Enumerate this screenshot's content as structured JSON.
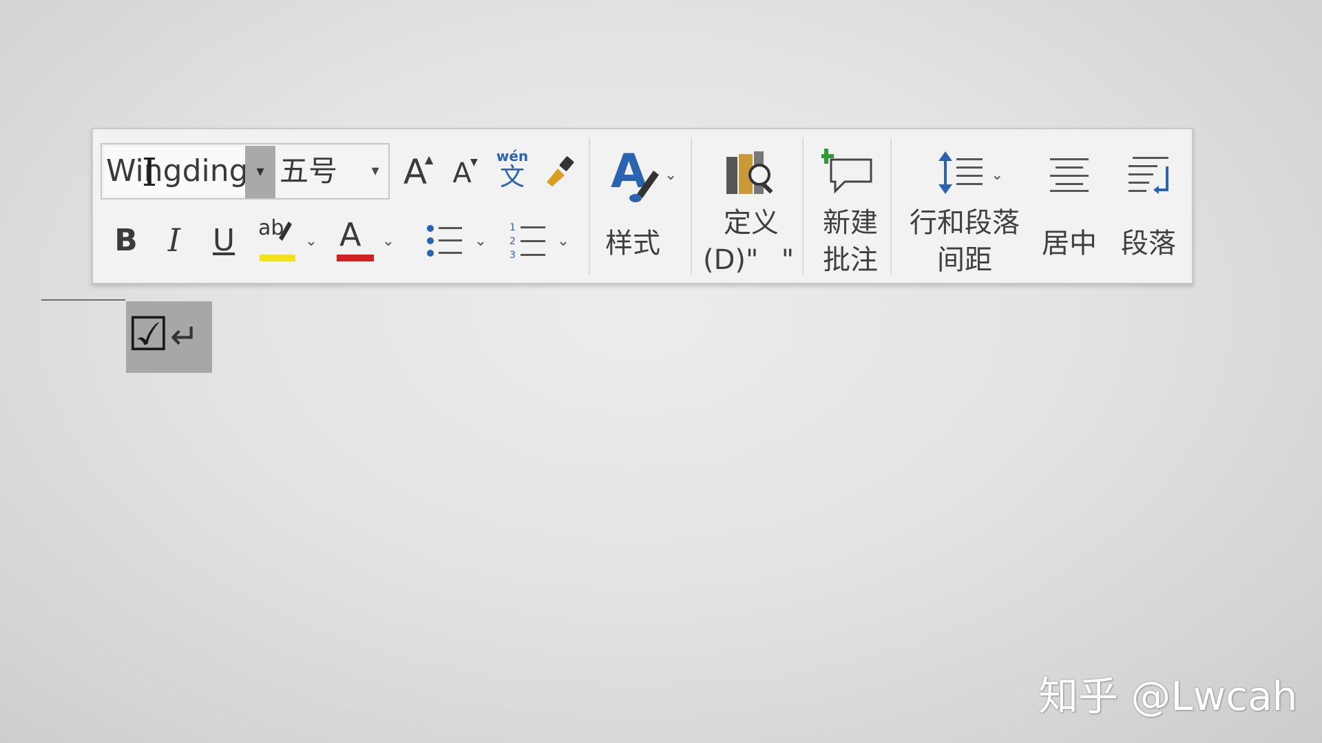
{
  "toolbar": {
    "font_name": "Wingding",
    "font_size": "五号",
    "wen_ruby": "wén",
    "wen_char": "文",
    "grow_font_glyph": "A",
    "shrink_font_glyph": "A",
    "bold_glyph": "B",
    "italic_glyph": "I",
    "underline_glyph": "U",
    "highlight_glyph": "ab",
    "font_color_glyph": "A",
    "styles_label": "样式",
    "define_label_line1": "定义",
    "define_label_line2": "(D)\"",
    "define_stray_quote": "\"",
    "new_comment_line1": "新建",
    "new_comment_line2": "批注",
    "line_spacing_line1": "行和段落",
    "line_spacing_line2": "间距",
    "center_label": "居中",
    "paragraph_label": "段落"
  },
  "document": {
    "checkbox_symbol": "☑",
    "return_symbol": "↵"
  },
  "watermark": {
    "text": "知乎 @Lwcah"
  },
  "colors": {
    "highlight": "#f2e21a",
    "font_color": "#d42020",
    "accent_blue": "#2a64b0",
    "toolbar_bg": "#f2f2f2",
    "selection_gray": "#a7a7a7"
  }
}
